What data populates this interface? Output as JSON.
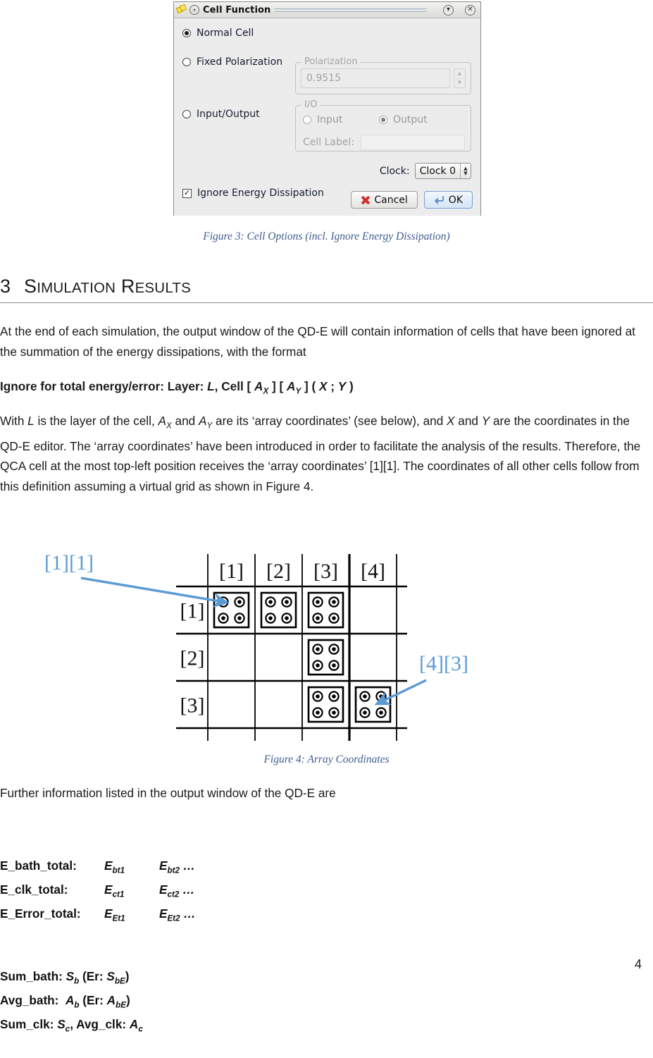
{
  "dialog": {
    "title": "Cell Function",
    "app_icon": "diamond-cells-icon",
    "menu_icon": "window-menu-icon",
    "shade_button": "chevron-down-icon",
    "close_button": "close-icon",
    "options": {
      "normal_cell": "Normal Cell",
      "fixed_polarization": "Fixed Polarization",
      "input_output": "Input/Output"
    },
    "polarization": {
      "group_title": "Polarization",
      "value": "0.9515"
    },
    "io": {
      "group_title": "I/O",
      "input_label": "Input",
      "output_label": "Output",
      "cell_label_caption": "Cell Label:",
      "cell_label_value": ""
    },
    "clock": {
      "label": "Clock:",
      "value": "Clock 0"
    },
    "ignore_energy": "Ignore Energy Dissipation",
    "buttons": {
      "cancel": "Cancel",
      "ok": "OK"
    }
  },
  "captions": {
    "figure3": "Figure 3: Cell Options (incl. Ignore Energy Dissipation)",
    "figure4": "Figure 4: Array Coordinates"
  },
  "heading": {
    "number": "3",
    "title": "SIMULATION RESULTS"
  },
  "paragraphs": {
    "p1": "At the end of each simulation, the output window of the QD-E will contain information of cells that have been ignored at the summation of the energy dissipations, with the format",
    "p2_html": "Ignore for total energy/error: Layer: <i>L</i>, Cell [ <i>A<sub>X</sub></i> ] [ <i>A<sub>Y</sub></i> ] ( <i>X</i> ; <i>Y</i> )",
    "p3_html": "With <i>L</i> is the layer of the cell, <i>A<sub>X</sub></i> and <i>A<sub>Y</sub></i> are its ‘array coordinates’ (see below), and <i>X</i> and <i>Y</i> are the coordinates in the QD-E editor. The ‘array coordinates’ have been introduced in order to facilitate the analysis of the results. Therefore, the QCA cell at the most top-left position receives the ‘array coordinates’ [1][1]. The coordinates of all other cells follow from this definition assuming a virtual grid as shown in Figure 4.",
    "p4": "Further information listed in the output window of the QD-E are"
  },
  "figure4": {
    "annotation_color": "#5b9bd5",
    "col_headers": [
      "[1]",
      "[2]",
      "[3]",
      "[4]"
    ],
    "row_headers": [
      "[1]",
      "[2]",
      "[3]"
    ],
    "occupied_cells": [
      [
        1,
        1
      ],
      [
        1,
        2
      ],
      [
        1,
        3
      ],
      [
        2,
        3
      ],
      [
        3,
        3
      ],
      [
        3,
        4
      ]
    ],
    "annotations": [
      {
        "label": "[1][1]",
        "target": "top-left-cell"
      },
      {
        "label": "[4][3]",
        "target": "bottom-right-cell"
      }
    ]
  },
  "formulas": [
    {
      "name": "E_bath_total:",
      "v1": "E<sub>bt1</sub>",
      "v2": "E<sub>bt2</sub> …"
    },
    {
      "name": "E_clk_total:",
      "v1": "E<sub>ct1</sub>",
      "v2": "E<sub>ct2</sub> …"
    },
    {
      "name": "E_Error_total:",
      "v1": "E<sub>Et1</sub>",
      "v2": "E<sub>Et2</sub> …"
    }
  ],
  "formulas_extra": [
    "Sum_bath: S<sub>b</sub> (Er: S<sub>bE</sub>)",
    "Avg_bath:  A<sub>b</sub> (Er: A<sub>bE</sub>)",
    "Sum_clk: S<sub>c</sub>, Avg_clk: A<sub>c</sub>"
  ],
  "page_number": "4"
}
